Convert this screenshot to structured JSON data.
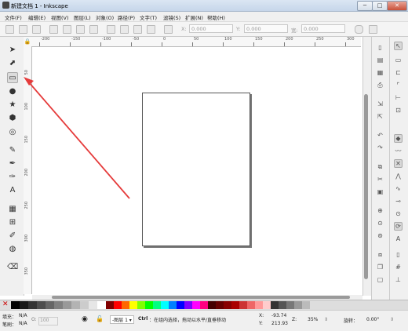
{
  "window": {
    "title": "新建文档 1 - Inkscape",
    "minimize": "─",
    "maximize": "□",
    "close": "✕"
  },
  "menu": [
    "文件(F)",
    "编辑(E)",
    "视图(V)",
    "图层(L)",
    "对象(O)",
    "路径(P)",
    "文字(T)",
    "滤镜(S)",
    "扩展(N)",
    "帮助(H)"
  ],
  "controls": {
    "x_label": "X:",
    "x_value": "0.000",
    "y_label": "Y:",
    "y_value": "0.000",
    "w_label": "宽:",
    "w_value": "0.000"
  },
  "ruler": {
    "h_ticks": [
      "-200",
      "-150",
      "-100",
      "-50",
      "0",
      "50",
      "100",
      "150",
      "200",
      "250",
      "300"
    ],
    "v_ticks": [
      "50",
      "100",
      "150",
      "200",
      "250",
      "300",
      "350"
    ]
  },
  "tools": [
    {
      "name": "selector-tool",
      "glyph": "➤"
    },
    {
      "name": "node-tool",
      "glyph": "⬈"
    },
    {
      "name": "rect-tool",
      "glyph": "▭"
    },
    {
      "name": "ellipse-tool",
      "glyph": "●"
    },
    {
      "name": "star-tool",
      "glyph": "★"
    },
    {
      "name": "3dbox-tool",
      "glyph": "⬢"
    },
    {
      "name": "spiral-tool",
      "glyph": "◎"
    },
    {
      "name": "pencil-tool",
      "glyph": "✎"
    },
    {
      "name": "pen-tool",
      "glyph": "✒"
    },
    {
      "name": "calligraphy-tool",
      "glyph": "✑"
    },
    {
      "name": "text-tool",
      "glyph": "A"
    },
    {
      "name": "spray-tool",
      "glyph": "▦"
    },
    {
      "name": "connector-tool",
      "glyph": "⊞"
    },
    {
      "name": "dropper-tool",
      "glyph": "✐"
    },
    {
      "name": "paint-bucket-tool",
      "glyph": "◍"
    },
    {
      "name": "eraser-tool",
      "glyph": "⌫"
    }
  ],
  "status": {
    "fill_label": "填充：",
    "fill_value": "N/A",
    "stroke_label": "笔刷：",
    "stroke_value": "N/A",
    "opacity_label": "O:",
    "opacity_value": "100",
    "layer": "-图层 1 ▾",
    "message_key": "Ctrl",
    "message": "：在组内选择，拖动以水平/直垂移动",
    "x_label": "X:",
    "x_value": "-93.74",
    "y_label": "Y:",
    "y_value": "213.93",
    "zoom_label": "Z:",
    "zoom_value": "35%",
    "rotate_label": "旋转：",
    "rotate_value": "0.00°"
  },
  "colors": {
    "accent_arrow": "#e53b3b"
  }
}
